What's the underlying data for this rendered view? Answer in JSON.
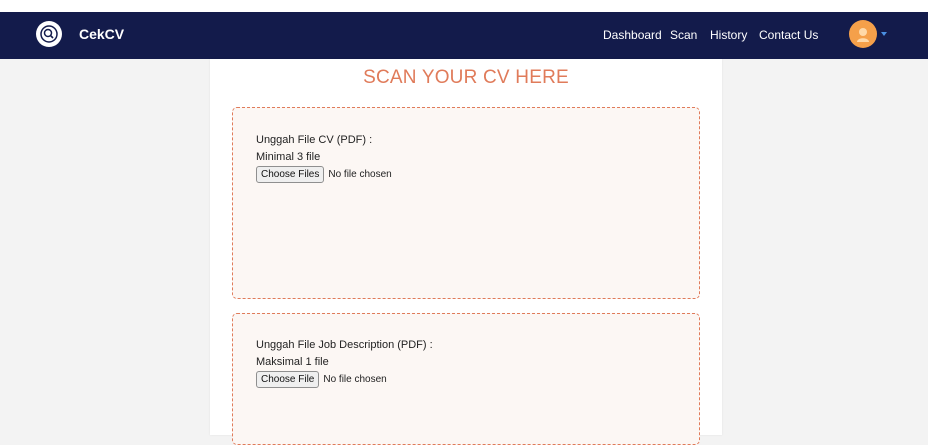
{
  "navbar": {
    "brand": "CekCV",
    "links": [
      "Dashboard",
      "Scan",
      "History",
      "Contact Us"
    ]
  },
  "page": {
    "title": "SCAN YOUR CV HERE"
  },
  "cv_upload": {
    "label": "Unggah File CV (PDF) :",
    "note": "Minimal 3 file",
    "button": "Choose Files",
    "status": "No file chosen"
  },
  "jd_upload": {
    "label": "Unggah File Job Description (PDF) :",
    "note": "Maksimal 1 file",
    "button": "Choose File",
    "status": "No file chosen"
  },
  "colors": {
    "navbar": "#131b4b",
    "accent": "#e07b5a",
    "box_background": "#fcf7f4",
    "avatar": "#f5a04a"
  },
  "icons": [
    "search-document-icon",
    "user-avatar-icon",
    "caret-down-icon"
  ]
}
